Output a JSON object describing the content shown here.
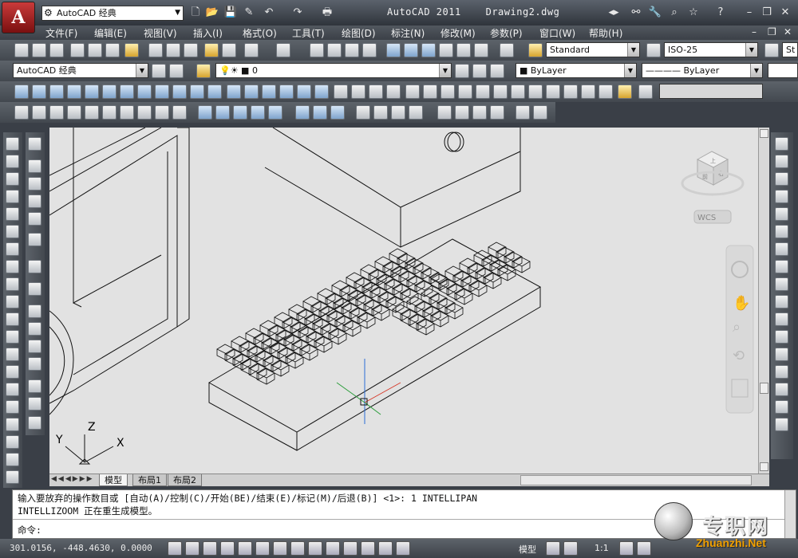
{
  "titlebar": {
    "app_icon": "A",
    "workspace": "AutoCAD 经典",
    "title_app": "AutoCAD 2011",
    "title_doc": "Drawing2.dwg"
  },
  "menu": [
    "文件(F)",
    "编辑(E)",
    "视图(V)",
    "插入(I)",
    "格式(O)",
    "工具(T)",
    "绘图(D)",
    "标注(N)",
    "修改(M)",
    "参数(P)",
    "窗口(W)",
    "帮助(H)"
  ],
  "toolbar2": {
    "text_style": "Standard",
    "dim_style": "ISO-25",
    "table_style_partial": "St"
  },
  "toolbar3": {
    "workspace": "AutoCAD 经典",
    "layer": "0",
    "color": "ByLayer",
    "linetype": "ByLayer"
  },
  "viewcube": {
    "face_top": "上",
    "face_front": "前",
    "face_right": "右",
    "wcs": "WCS"
  },
  "ucs": {
    "x": "X",
    "y": "Y",
    "z": "Z"
  },
  "tabs": [
    "模型",
    "布局1",
    "布局2"
  ],
  "command": {
    "line1": "输入要放弃的操作数目或 [自动(A)/控制(C)/开始(BE)/结束(E)/标记(M)/后退(B)] <1>: 1 INTELLIPAN",
    "line2": "INTELLIZOOM 正在重生成模型。",
    "prompt": "命令:"
  },
  "status": {
    "coords": "301.0156, -448.4630, 0.0000",
    "model": "模型",
    "scale": "1:1"
  },
  "watermark": {
    "cn": "专职网",
    "en": "Zhuanzhi.Net"
  }
}
